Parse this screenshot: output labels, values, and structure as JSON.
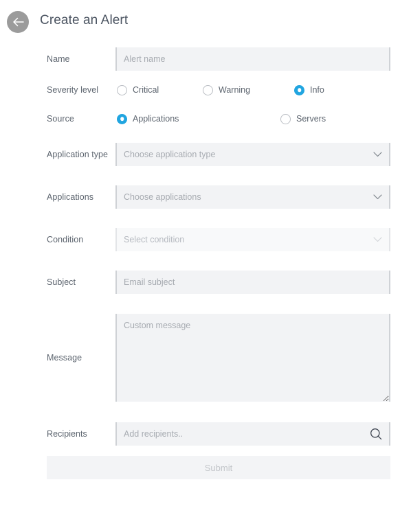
{
  "header": {
    "title": "Create an Alert",
    "back_icon": "arrow-left-icon"
  },
  "form": {
    "name": {
      "label": "Name",
      "placeholder": "Alert name",
      "value": ""
    },
    "severity": {
      "label": "Severity level",
      "options": [
        {
          "label": "Critical",
          "selected": false
        },
        {
          "label": "Warning",
          "selected": false
        },
        {
          "label": "Info",
          "selected": true
        }
      ]
    },
    "source": {
      "label": "Source",
      "options": [
        {
          "label": "Applications",
          "selected": true
        },
        {
          "label": "Servers",
          "selected": false
        }
      ]
    },
    "application_type": {
      "label": "Application type",
      "placeholder": "Choose application type",
      "value": "",
      "disabled": false,
      "chevron_icon": "chevron-down-icon"
    },
    "applications": {
      "label": "Applications",
      "placeholder": "Choose applications",
      "value": "",
      "disabled": false,
      "chevron_icon": "chevron-down-icon"
    },
    "condition": {
      "label": "Condition",
      "placeholder": "Select condition",
      "value": "",
      "disabled": true,
      "chevron_icon": "chevron-down-icon"
    },
    "subject": {
      "label": "Subject",
      "placeholder": "Email subject",
      "value": ""
    },
    "message": {
      "label": "Message",
      "placeholder": "Custom message",
      "value": ""
    },
    "recipients": {
      "label": "Recipients",
      "placeholder": "Add recipients..",
      "value": "",
      "search_icon": "search-icon"
    },
    "submit": {
      "label": "Submit",
      "disabled": true
    }
  },
  "colors": {
    "accent": "#21a5e0",
    "field_bg": "#f2f3f5",
    "field_bg_disabled": "#f8f9fa",
    "label_text": "#5d656f",
    "placeholder_text": "#a7abb1",
    "title_text": "#4a5360",
    "back_button_bg": "#9b9b9b"
  }
}
